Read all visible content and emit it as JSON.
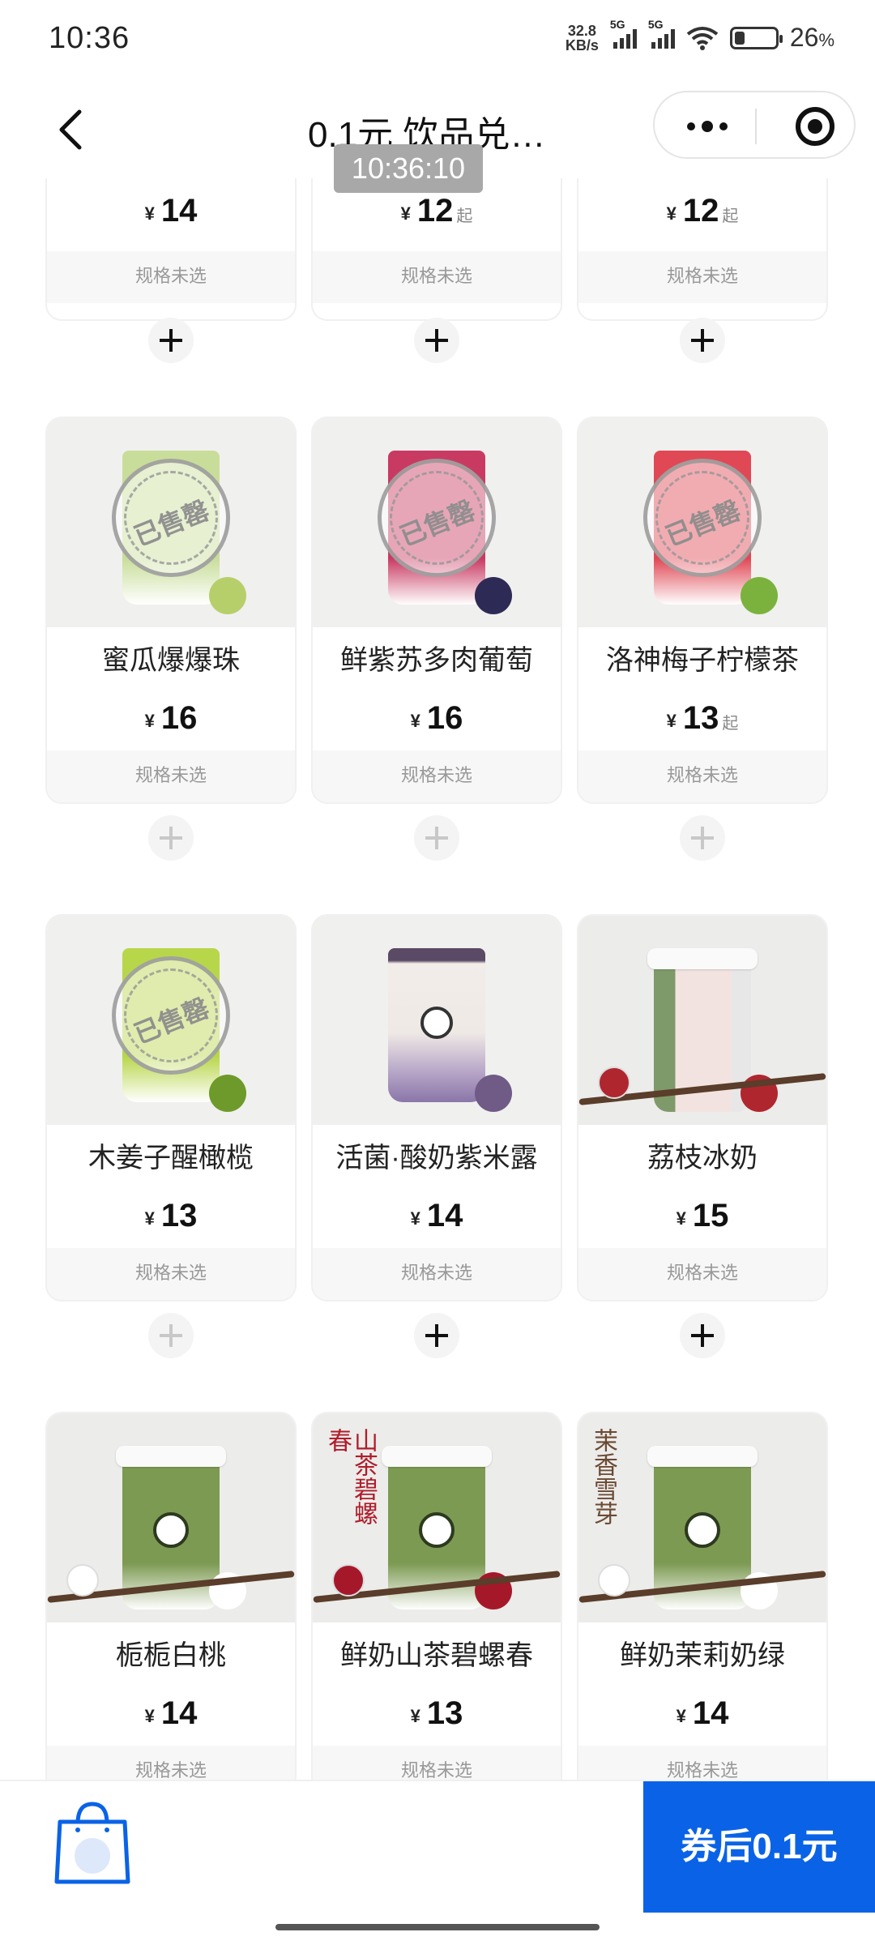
{
  "status_bar": {
    "time": "10:36",
    "net_speed_top": "32.8",
    "net_speed_bottom": "KB/s",
    "sig1_label": "5G",
    "sig2_label": "5G",
    "battery_percent": "26",
    "battery_unit": "%"
  },
  "nav": {
    "title": "0.1元 饮品兑…",
    "timestamp_toast": "10:36:10"
  },
  "currency": "¥",
  "spec_label": "规格未选",
  "qi_label": "起",
  "sold_out_label": "已售罄",
  "top_row": [
    {
      "price": "14",
      "qi": false,
      "add_enabled": true
    },
    {
      "price": "12",
      "qi": true,
      "add_enabled": true
    },
    {
      "price": "12",
      "qi": true,
      "add_enabled": true
    }
  ],
  "products": [
    {
      "name": "蜜瓜爆爆珠",
      "price": "16",
      "qi": false,
      "sold_out": true,
      "add_enabled": false,
      "cup_color": "#c9dd9a",
      "accent": "#b7cf6a"
    },
    {
      "name": "鲜紫苏多肉葡萄",
      "price": "16",
      "qi": false,
      "sold_out": true,
      "add_enabled": false,
      "cup_color": "#c93a63",
      "accent": "#2d2a55"
    },
    {
      "name": "洛神梅子柠檬茶",
      "price": "13",
      "qi": true,
      "sold_out": true,
      "add_enabled": false,
      "cup_color": "#e04855",
      "accent": "#7ab23d"
    },
    {
      "name": "木姜子醒橄榄",
      "price": "13",
      "qi": false,
      "sold_out": true,
      "add_enabled": false,
      "cup_color": "#b8d64a",
      "accent": "#6d9a2a"
    },
    {
      "name": "活菌·酸奶紫米露",
      "price": "14",
      "qi": false,
      "sold_out": false,
      "add_enabled": true,
      "cup_color": "#e7dde6",
      "accent": "#6f5b86"
    },
    {
      "name": "荔枝冰奶",
      "price": "15",
      "qi": false,
      "sold_out": false,
      "add_enabled": true,
      "cup_color": "#f4f4f4",
      "accent": "#b0262f"
    },
    {
      "name": "栀栀白桃",
      "price": "14",
      "qi": false,
      "sold_out": false,
      "add_enabled": true,
      "cup_color": "#7d9a52",
      "accent": "#ffffff"
    },
    {
      "name": "鲜奶山茶碧螺春",
      "price": "13",
      "qi": false,
      "sold_out": false,
      "add_enabled": true,
      "cup_color": "#7d9a52",
      "accent": "#a5182a"
    },
    {
      "name": "鲜奶茉莉奶绿",
      "price": "14",
      "qi": false,
      "sold_out": false,
      "add_enabled": true,
      "cup_color": "#7d9a52",
      "accent": "#ffffff"
    }
  ],
  "poster_texts": {
    "shancha": "山茶碧螺春",
    "moli": "茉香雪芽"
  },
  "bottom_bar": {
    "checkout_label": "券后0.1元",
    "accent_color": "#0a63e6"
  }
}
